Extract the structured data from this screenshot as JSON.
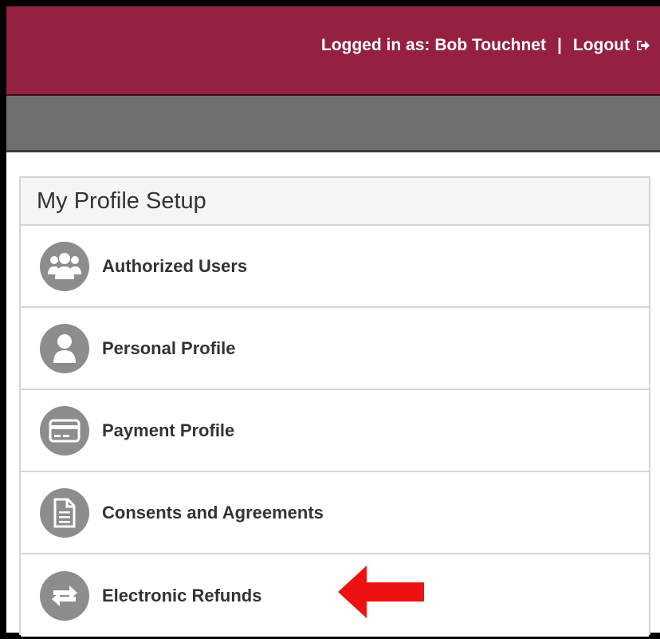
{
  "header": {
    "logged_in_prefix": "Logged in as:",
    "user_name": "Bob Touchnet",
    "separator": "|",
    "logout_label": "Logout",
    "logout_icon": "logout-icon",
    "brand_color": "#952042"
  },
  "subnav": {
    "color": "#6f6f70"
  },
  "profile_setup": {
    "title": "My Profile Setup",
    "items": [
      {
        "label": "Authorized Users",
        "icon": "users-icon"
      },
      {
        "label": "Personal Profile",
        "icon": "user-icon"
      },
      {
        "label": "Payment Profile",
        "icon": "credit-card-icon"
      },
      {
        "label": "Consents and Agreements",
        "icon": "document-icon"
      },
      {
        "label": "Electronic Refunds",
        "icon": "refresh-icon"
      }
    ]
  },
  "annotation": {
    "arrow_color": "#ee1111",
    "points_to": "Electronic Refunds"
  }
}
